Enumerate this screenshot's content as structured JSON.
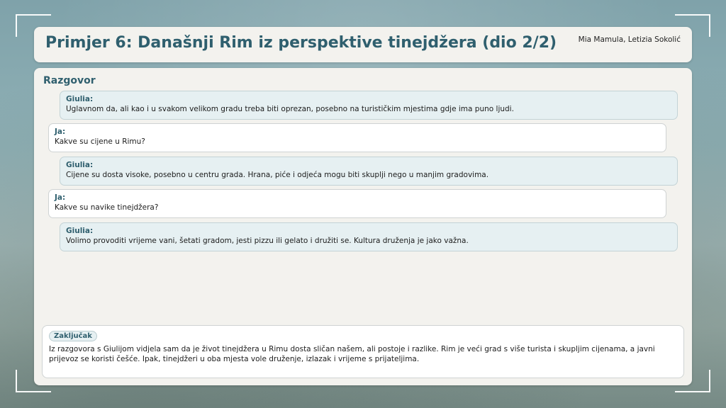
{
  "header": {
    "title": "Primjer 6: Današnji Rim iz perspektive tinejdžera (dio 2/2)",
    "authors": "Mia Mamula, Letizia Sokolić"
  },
  "conversation": {
    "title": "Razgovor",
    "messages": [
      {
        "speaker": "Giulia:",
        "text": "Uglavnom da, ali kao i u svakom velikom gradu treba biti oprezan, posebno na turističkim mjestima gdje ima puno ljudi."
      },
      {
        "speaker": "Ja:",
        "text": "Kakve su cijene u Rimu?"
      },
      {
        "speaker": "Giulia:",
        "text": "Cijene su dosta visoke, posebno u centru grada. Hrana, piće i odjeća mogu biti skuplji nego u manjim gradovima."
      },
      {
        "speaker": "Ja:",
        "text": "Kakve su navike tinejdžera?"
      },
      {
        "speaker": "Giulia:",
        "text": "Volimo provoditi vrijeme vani, šetati gradom, jesti pizzu ili gelato i družiti se. Kultura druženja je jako važna."
      }
    ]
  },
  "summary": {
    "label": "Zaključak",
    "text": "Iz razgovora s Giulijom vidjela sam da je život tinejdžera u Rimu dosta sličan našem, ali postoje i razlike. Rim je veći grad s više turista i skupljim cijenama, a javni prijevoz se koristi češće. Ipak, tinejdžeri u oba mjesta vole druženje, izlazak i vrijeme s prijateljima."
  },
  "colors": {
    "accent": "#2f5f6e",
    "panel": "#f3f2ee",
    "giulia_bubble": "#e6f0f2",
    "ja_bubble": "#ffffff"
  }
}
